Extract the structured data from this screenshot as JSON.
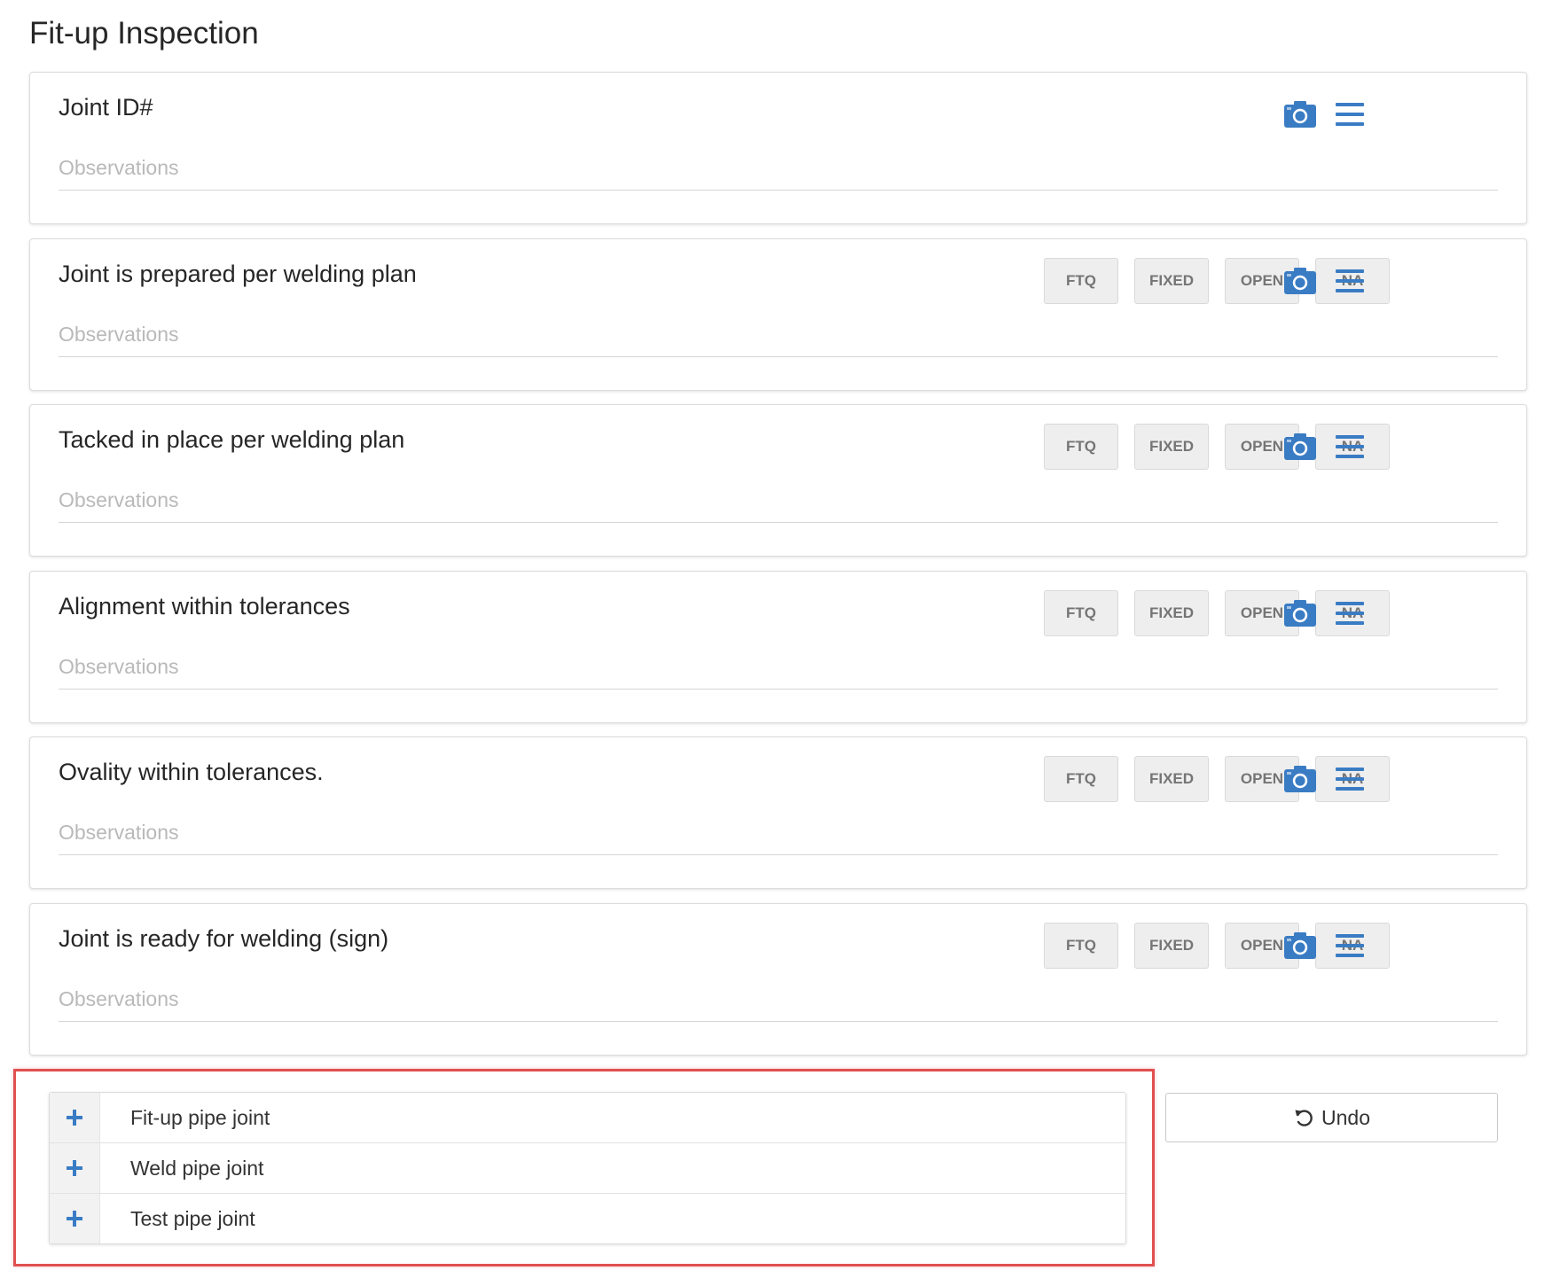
{
  "page": {
    "title": "Fit-up Inspection"
  },
  "colors": {
    "accent": "#3a7cc4",
    "status_button_bg": "#eeeeee",
    "status_button_text": "#757575",
    "highlight": "#e05050"
  },
  "status_buttons": [
    "FTQ",
    "FIXED",
    "OPEN",
    "NA"
  ],
  "items": [
    {
      "title": "Joint ID#",
      "observations_placeholder": "Observations",
      "has_status": false
    },
    {
      "title": "Joint is prepared per welding plan",
      "observations_placeholder": "Observations",
      "has_status": true
    },
    {
      "title": "Tacked in place per welding plan",
      "observations_placeholder": "Observations",
      "has_status": true
    },
    {
      "title": "Alignment within tolerances",
      "observations_placeholder": "Observations",
      "has_status": true
    },
    {
      "title": "Ovality within tolerances.",
      "observations_placeholder": "Observations",
      "has_status": true
    },
    {
      "title": "Joint is ready for welding (sign)",
      "observations_placeholder": "Observations",
      "has_status": true
    }
  ],
  "icons": {
    "camera": "camera-icon",
    "menu": "hamburger-menu-icon",
    "add": "plus-icon",
    "undo": "undo-icon"
  },
  "actions": [
    {
      "label": "Fit-up pipe joint"
    },
    {
      "label": "Weld pipe joint"
    },
    {
      "label": "Test pipe joint"
    }
  ],
  "undo": {
    "label": "Undo"
  }
}
